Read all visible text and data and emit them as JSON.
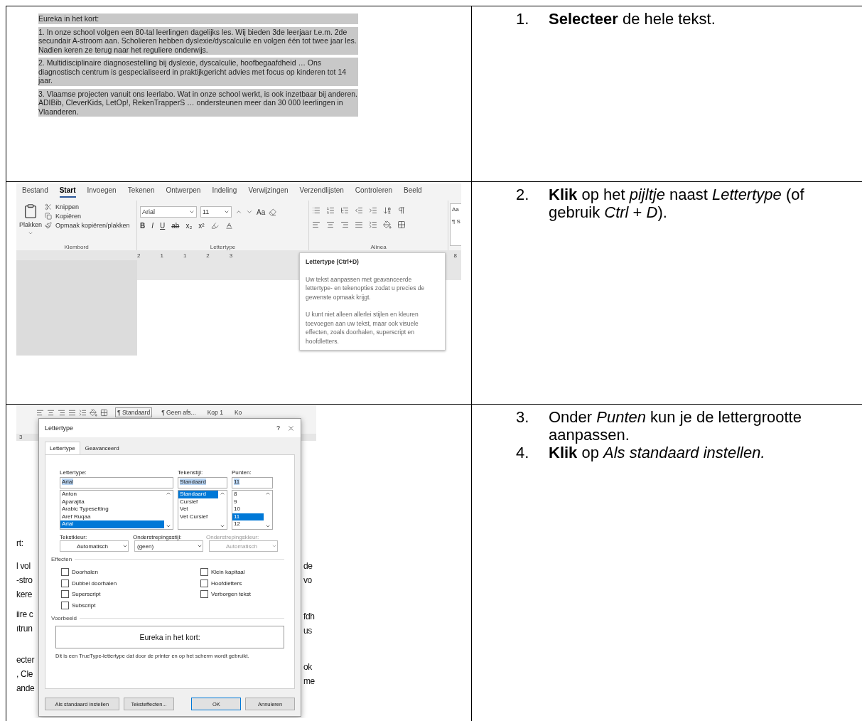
{
  "table": {
    "rows": [
      {
        "screenshot": {
          "kind": "selected_text",
          "paragraphs": [
            "Eureka in het kort:",
            "1. In onze school volgen een 80-tal leerlingen dagelijks les. Wij bieden 3de leerjaar t.e.m. 2de secundair A-stroom aan. Scholieren hebben dyslexie/dyscalculie en volgen één tot twee jaar les. Nadien keren ze terug naar het reguliere onderwijs.",
            "2. Multidisciplinaire diagnosestelling bij dyslexie, dyscalculie, hoofbegaafdheid … Ons diagnostisch centrum is gespecialiseerd in praktijkgericht advies met focus op kinderen tot 14 jaar.",
            "3. Vlaamse projecten vanuit ons leerlabo. Wat in onze school werkt, is ook inzetbaar bij anderen. ADIBib, CleverKids, LetOp!, RekenTrapperS … ondersteunen meer dan 30 000 leerlingen in Vlaanderen."
          ]
        },
        "steps": [
          {
            "number": "1.",
            "text": "**Selecteer** de hele tekst."
          }
        ]
      },
      {
        "screenshot": {
          "kind": "ribbon",
          "tabs": [
            {
              "label": "Bestand",
              "selected": false
            },
            {
              "label": "Start",
              "selected": true
            },
            {
              "label": "Invoegen",
              "selected": false
            },
            {
              "label": "Tekenen",
              "selected": false
            },
            {
              "label": "Ontwerpen",
              "selected": false
            },
            {
              "label": "Indeling",
              "selected": false
            },
            {
              "label": "Verwijzingen",
              "selected": false
            },
            {
              "label": "Verzendlijsten",
              "selected": false
            },
            {
              "label": "Controleren",
              "selected": false
            },
            {
              "label": "Beeld",
              "selected": false
            }
          ],
          "clipboard": {
            "paste": "Plakken",
            "cut": "Knippen",
            "copy": "Kopiëren",
            "format_painter": "Opmaak kopiëren/plakken",
            "label": "Klembord"
          },
          "font": {
            "name": "Arial",
            "size": "11",
            "case": "Aa",
            "format_buttons": [
              "B",
              "I",
              "U",
              "ab",
              "x₂",
              "x²"
            ],
            "label": "Lettertype"
          },
          "paragraph": {
            "label": "Alinea"
          },
          "styles": [
            "Aa",
            "¶ S"
          ],
          "ruler": [
            "2",
            "1",
            "1",
            "2",
            "3",
            "8"
          ],
          "tooltip": {
            "title": "Lettertype (Ctrl+D)",
            "paragraphs": [
              "Uw tekst aanpassen met geavanceerde lettertype- en tekenopties zodat u precies de gewenste opmaak krijgt.",
              "U kunt niet alleen allerlei stijlen en kleuren toevoegen aan uw tekst, maar ook visuele effecten, zoals doorhalen, superscript en hoofdletters."
            ]
          }
        },
        "steps": [
          {
            "number": "2.",
            "text": "**Klik** op het *pijltje* naast *Lettertype* (of gebruik *Ctrl* + *D*)."
          }
        ]
      },
      {
        "screenshot": {
          "kind": "dialog",
          "styles": [
            "¶ Standaard",
            "¶ Geen afs...",
            "Kop 1",
            "Ko"
          ],
          "ruler": "3",
          "left_fragments": [
            "rt:",
            "l vol",
            "-stro",
            "kere",
            "iire c",
            "ıtrun",
            "ecter",
            ", Cle",
            "ande"
          ],
          "right_fragments": [
            "de",
            "vo",
            "fdh",
            "us",
            "ok",
            "me"
          ],
          "dialog": {
            "title": "Lettertype",
            "help": "?",
            "tabs": [
              {
                "label": "Lettertype",
                "selected": true
              },
              {
                "label": "Geavanceerd",
                "selected": false
              }
            ],
            "font": {
              "label": "Lettertype:",
              "value": "Arial",
              "items": [
                {
                  "label": "Anton",
                  "selected": false
                },
                {
                  "label": "Aparajita",
                  "selected": false
                },
                {
                  "label": "Arabic Typesetting",
                  "selected": false
                },
                {
                  "label": "Aref Ruqaa",
                  "selected": false
                },
                {
                  "label": "Arial",
                  "selected": true
                }
              ]
            },
            "style": {
              "label": "Tekenstijl:",
              "value": "Standaard",
              "items": [
                {
                  "label": "Standaard",
                  "selected": true
                },
                {
                  "label": "Cursief",
                  "selected": false
                },
                {
                  "label": "Vet",
                  "selected": false
                },
                {
                  "label": "Vet Cursief",
                  "selected": false
                }
              ]
            },
            "size": {
              "label": "Punten:",
              "value": "11",
              "items": [
                {
                  "label": "8",
                  "selected": false
                },
                {
                  "label": "9",
                  "selected": false
                },
                {
                  "label": "10",
                  "selected": false
                },
                {
                  "label": "11",
                  "selected": true
                },
                {
                  "label": "12",
                  "selected": false
                }
              ]
            },
            "dropdowns": [
              {
                "label": "Tekstkleur:",
                "value": "Automatisch",
                "disabled": false
              },
              {
                "label": "Onderstrepingsstijl:",
                "value": "(geen)",
                "disabled": false
              },
              {
                "label": "Onderstrepingskleur:",
                "value": "Automatisch",
                "disabled": true
              }
            ],
            "effects_label": "Effecten",
            "effects_left": [
              {
                "label": "Doorhalen",
                "checked": false
              },
              {
                "label": "Dubbel doorhalen",
                "checked": false
              },
              {
                "label": "Superscript",
                "checked": false
              },
              {
                "label": "Subscript",
                "checked": false
              }
            ],
            "effects_right": [
              {
                "label": "Klein kapitaal",
                "checked": false
              },
              {
                "label": "Hoofdletters",
                "checked": false
              },
              {
                "label": "Verborgen tekst",
                "checked": false
              }
            ],
            "preview_label": "Voorbeeld",
            "preview_text": "Eureka in het kort:",
            "note": "Dit is een TrueType-lettertype dat door de printer en op het scherm wordt gebruikt.",
            "buttons": [
              {
                "label": "Als standaard instellen",
                "default": false
              },
              {
                "label": "Teksteffecten...",
                "default": false
              },
              {
                "label": "OK",
                "default": true
              },
              {
                "label": "Annuleren",
                "default": false
              }
            ]
          }
        },
        "steps": [
          {
            "number": "3.",
            "text": "Onder *Punten* kun je de lettergrootte aanpassen."
          },
          {
            "number": "4.",
            "text": "**Klik** op *Als standaard instellen.*"
          }
        ]
      }
    ]
  }
}
